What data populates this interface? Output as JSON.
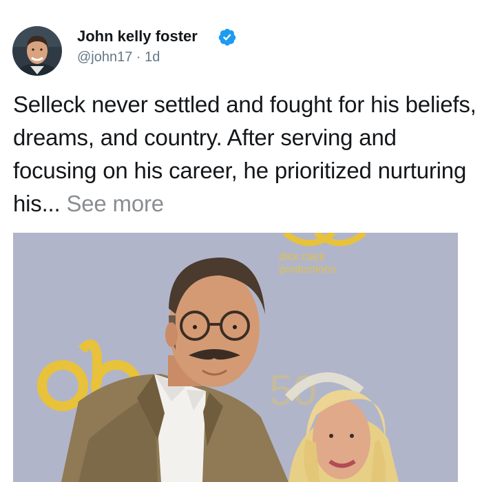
{
  "post": {
    "author": {
      "name": "John kelly foster",
      "handle": "@john17",
      "separator": " · ",
      "time": "1d",
      "verified": true
    },
    "text": "Selleck never settled and fought for his beliefs, dreams, and country. After serving and focusing on his career, he prioritized nurturing his...",
    "see_more": "See more",
    "photo": {
      "backdrop_logo_lines": [
        "dick clark",
        "productions"
      ],
      "backdrop_number": "50"
    }
  },
  "colors": {
    "verified_badge": "#1d9bf0",
    "text_primary": "#14171a",
    "text_secondary": "#657786",
    "see_more": "#8a8d91",
    "photo_backdrop": "#aeb3c7",
    "logo_gold": "#e8c23a"
  },
  "icons": {
    "verified": "verified-badge-icon"
  }
}
